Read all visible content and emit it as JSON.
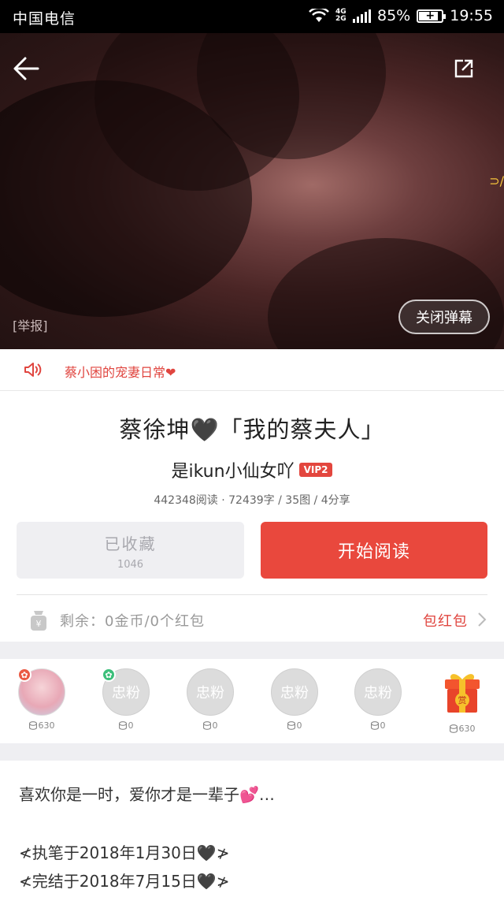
{
  "status_bar": {
    "carrier": "中国电信",
    "network": "4G 2G",
    "battery": "85%",
    "time": "19:55"
  },
  "hero": {
    "report": "[举报]",
    "danmaku_button": "关闭弹幕",
    "edge_mark": "⊃/"
  },
  "notice": {
    "text": "蔡小困的宠妻日常❤"
  },
  "book": {
    "title": "蔡徐坤🖤「我的蔡夫人」",
    "author": "是ikun小仙女吖",
    "vip": "VIP2",
    "stats": "442348阅读 · 72439字 / 35图 / 4分享"
  },
  "actions": {
    "favorite_label": "已收藏",
    "favorite_count": "1046",
    "read_label": "开始阅读"
  },
  "balance": {
    "text": "剩余：0金币/0个红包",
    "redpack_label": "包红包"
  },
  "fans": [
    {
      "label": "",
      "coins": "630",
      "type": "avatar",
      "badge_color": "#ea5a44"
    },
    {
      "label": "忠粉",
      "coins": "0",
      "type": "placeholder",
      "badge_color": "#3cbf7a"
    },
    {
      "label": "忠粉",
      "coins": "0",
      "type": "placeholder"
    },
    {
      "label": "忠粉",
      "coins": "0",
      "type": "placeholder"
    },
    {
      "label": "忠粉",
      "coins": "0",
      "type": "placeholder"
    },
    {
      "label": "赏",
      "coins": "630",
      "type": "gift"
    }
  ],
  "description": {
    "line1": "喜欢你是一时，爱你才是一辈子💕…",
    "line2": "≮执笔于2018年1月30日🖤≯",
    "line3": "≮完结于2018年7月15日🖤≯"
  },
  "colors": {
    "accent": "#e9483d",
    "text_red": "#e0453f"
  }
}
